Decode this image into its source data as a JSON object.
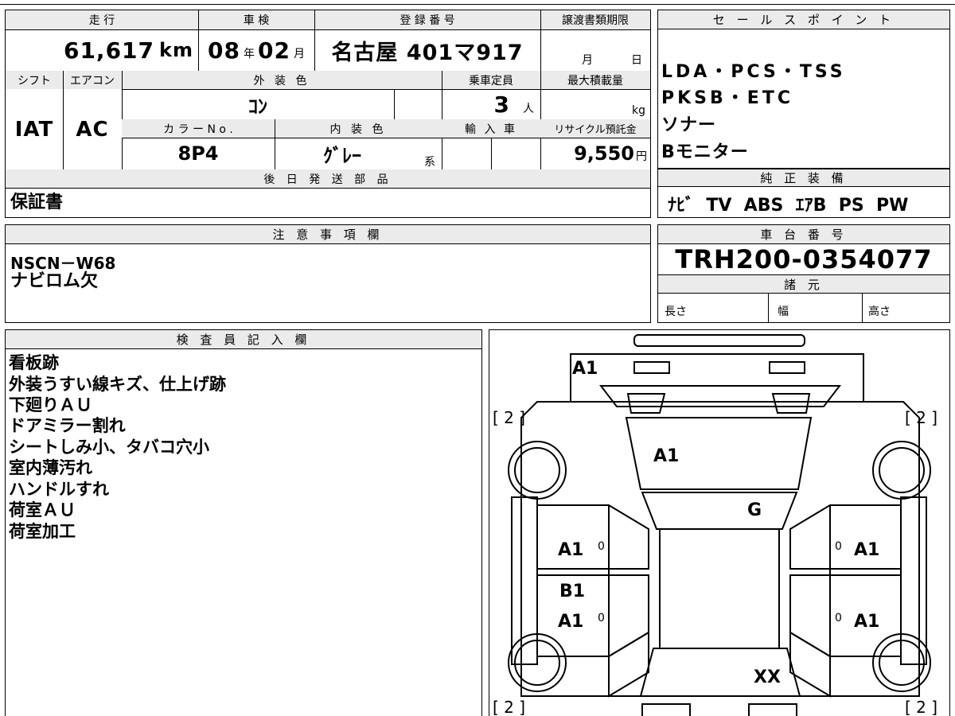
{
  "vehicle": {
    "mileage_label": "走 行",
    "mileage": "61,617",
    "mileage_unit": "km",
    "shaken_label": "車 検",
    "shaken_year": "08",
    "shaken_year_unit": "年",
    "shaken_month": "02",
    "shaken_month_unit": "月",
    "reg_label": "登 録 番 号",
    "reg_number": "名古屋 401マ917",
    "transfer_label": "譲渡書類期限",
    "transfer_month_unit": "月",
    "transfer_day_unit": "日",
    "shift_label": "シフト",
    "shift": "IAT",
    "ac_label": "エアコン",
    "ac": "AC",
    "exterior_label": "外 装 色",
    "exterior": "ｺﾝ",
    "capacity_label": "乗車定員",
    "capacity": "3",
    "capacity_unit": "人",
    "maxload_label": "最大積載量",
    "maxload_unit": "kg",
    "color_no_label": "カ ラ ー N o .",
    "color_no": "8P4",
    "interior_label": "内 装 色",
    "interior": "ｸﾞﾚｰ",
    "interior_unit": "系",
    "import_label": "輸 入 車",
    "recycle_label": "リサイクル預託金",
    "recycle": "9,550",
    "recycle_unit": "円",
    "later_label": "後 日 発 送 部 品",
    "later_parts": "保証書"
  },
  "sales": {
    "label": "セ ー ル ス ポ イ ン ト",
    "lines": [
      "LDA・PCS・TSS",
      "PKSB・ETC",
      "ソナー",
      "Bモニター"
    ]
  },
  "equipment": {
    "label": "純 正 装 備",
    "value": "ﾅﾋﾞ  TV  ABS  ｴｱB  PS  PW"
  },
  "notes": {
    "label": "注 意 事 項 欄",
    "lines": [
      "NSCN－W68",
      "ナビロム欠"
    ]
  },
  "chassis": {
    "label": "車 台 番 号",
    "number": "TRH200-0354077",
    "spec_label": "諸 元",
    "length_label": "長さ",
    "width_label": "幅",
    "height_label": "高さ"
  },
  "inspector": {
    "label": "検 査 員 記 入 欄",
    "lines": [
      "看板跡",
      "外装うすい線キズ、仕上げ跡",
      "下廻りＡＵ",
      "ドアミラー割れ",
      "シートしみ小、タバコ穴小",
      "室内薄汚れ",
      "ハンドルすれ",
      "荷室ＡＵ",
      "荷室加工"
    ]
  },
  "diagram": {
    "roof": "A1",
    "windshield": "A1",
    "hood": "G",
    "left_front_door": "A1",
    "left_rear_door_b": "B1",
    "left_rear_door": "A1",
    "right_front_door": "A1",
    "right_rear_door": "A1",
    "rear": "XX",
    "tire_tl": "[ 2 ]",
    "tire_tr": "[ 2 ]",
    "tire_bl": "[ 2 ]",
    "tire_br": "[ 2 ]",
    "zero": "0"
  }
}
